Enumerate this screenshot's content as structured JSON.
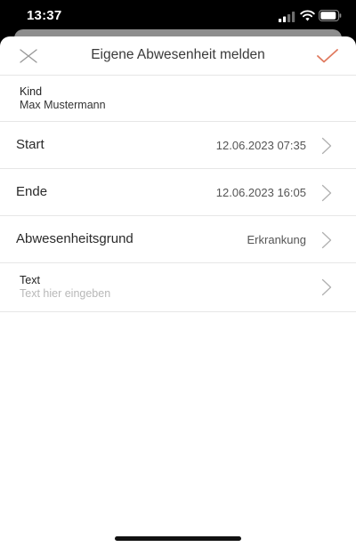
{
  "status_bar": {
    "time": "13:37"
  },
  "header": {
    "title": "Eigene Abwesenheit melden",
    "close_icon": "close-icon",
    "confirm_icon": "checkmark-icon"
  },
  "form": {
    "kind": {
      "label": "Kind",
      "value": "Max Mustermann"
    },
    "start": {
      "label": "Start",
      "value": "12.06.2023 07:35"
    },
    "ende": {
      "label": "Ende",
      "value": "12.06.2023 16:05"
    },
    "grund": {
      "label": "Abwesenheitsgrund",
      "value": "Erkrankung"
    },
    "text": {
      "label": "Text",
      "placeholder": "Text hier eingeben"
    }
  },
  "colors": {
    "accent": "#e07a5f",
    "separator": "#e6e6e6",
    "placeholder": "#b8b8b8",
    "chevron": "#b0b0b0"
  }
}
